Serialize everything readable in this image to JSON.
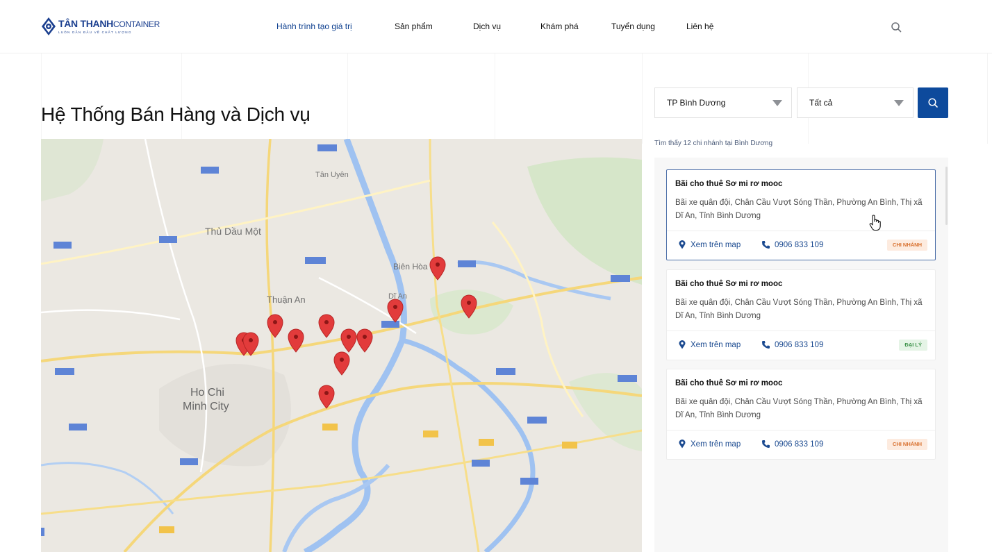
{
  "header": {
    "logo": {
      "brand_bold": "TÂN THANH",
      "brand_light": "CONTAINER",
      "tagline": "LUÔN DẪN ĐẦU VỀ CHẤT LƯỢNG"
    },
    "nav": [
      {
        "label": "Hành trình tạo giá trị",
        "active": true
      },
      {
        "label": "Sản phẩm"
      },
      {
        "label": "Dịch vụ"
      },
      {
        "label": "Khám phá"
      },
      {
        "label": "Tuyển dụng"
      },
      {
        "label": "Liên hệ"
      }
    ],
    "search_icon": "search-icon"
  },
  "page": {
    "title": "Hệ Thống Bán Hàng và Dịch vụ"
  },
  "map": {
    "labels": [
      "Thủ Dầu Một",
      "Thuận An",
      "Biên Hòa",
      "Tân Uyên",
      "Dĩ An",
      "Ho Chi",
      "Minh City"
    ],
    "marker_color": "#e23b3b",
    "marker_count": 13
  },
  "filters": {
    "province": "TP Bình Dương",
    "type": "Tất cả",
    "search_icon": "search-icon"
  },
  "results": {
    "summary": "Tìm thấy 12 chi nhánh tại Bình Dương",
    "items": [
      {
        "title": "Bãi cho thuê Sơ mi rơ mooc",
        "address": "Bãi xe quân đội, Chân Cầu Vượt Sóng Thần, Phường An Bình, Thị xã Dĩ An, Tỉnh Bình Dương",
        "map_link": "Xem trên map",
        "phone": "0906 833 109",
        "badge": "CHI NHÁNH"
      },
      {
        "title": "Bãi cho thuê Sơ mi rơ mooc",
        "address": "Bãi xe quân đội, Chân Cầu Vượt Sóng Thần, Phường An Bình, Thị xã Dĩ An, Tỉnh Bình Dương",
        "map_link": "Xem trên map",
        "phone": "0906 833 109",
        "badge": "ĐẠI LÝ"
      },
      {
        "title": "Bãi cho thuê Sơ mi rơ mooc",
        "address": "Bãi xe quân đội, Chân Cầu Vượt Sóng Thần, Phường An Bình, Thị xã Dĩ An, Tỉnh Bình Dương",
        "map_link": "Xem trên map",
        "phone": "0906 833 109",
        "badge": "CHI NHÁNH"
      }
    ]
  },
  "colors": {
    "brand": "#1b3f8f",
    "accent": "#0d4a9c",
    "badge_branch": "#d8702e",
    "badge_agent": "#3b9148"
  }
}
